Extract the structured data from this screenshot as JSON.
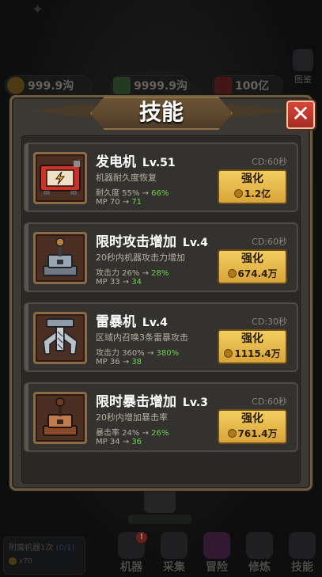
{
  "resources": [
    {
      "icon": "coin-icon",
      "value": "999.9沟"
    },
    {
      "icon": "cash-icon",
      "value": "9999.9沟"
    },
    {
      "icon": "gem-icon",
      "value": "100亿"
    }
  ],
  "handbook_label": "图鉴",
  "panel": {
    "title": "技能",
    "close_symbol": "✕"
  },
  "skills": [
    {
      "name": "发电机",
      "level": "Lv.51",
      "cd": "CD:60秒",
      "desc": "机器耐久度恢复",
      "stat": "耐久度 55% → ",
      "stat_new": "66%",
      "mp": "MP 70 → ",
      "mp_new": "71",
      "btn": "强化",
      "cost": "1.2亿",
      "icon": "generator-icon"
    },
    {
      "name": "限时攻击增加",
      "level": "Lv.4",
      "cd": "CD:60秒",
      "desc": "20秒内机器攻击力增加",
      "stat": "攻击力 26% → ",
      "stat_new": "28%",
      "mp": "MP 33 → ",
      "mp_new": "34",
      "btn": "强化",
      "cost": "674.4万",
      "icon": "attack-lever-icon"
    },
    {
      "name": "雷暴机",
      "level": "Lv.4",
      "cd": "CD:30秒",
      "desc": "区域内召唤3条雷暴攻击",
      "stat": "攻击力 360% → ",
      "stat_new": "380%",
      "mp": "MP 36 → ",
      "mp_new": "38",
      "btn": "强化",
      "cost": "1115.4万",
      "icon": "thunder-claw-icon"
    },
    {
      "name": "限时暴击增加",
      "level": "Lv.3",
      "cd": "CD:60秒",
      "desc": "20秒内增加暴击率",
      "stat": "暴击率 24% → ",
      "stat_new": "26%",
      "mp": "MP 34 → ",
      "mp_new": "36",
      "btn": "强化",
      "cost": "761.4万",
      "icon": "crit-lever-icon"
    }
  ],
  "bottom": {
    "enemy_text": "附魔机器1次",
    "enemy_count": "(0/1)",
    "reward": "x70",
    "nav": [
      {
        "label": "机器",
        "badge": "!"
      },
      {
        "label": "采集",
        "badge": ""
      },
      {
        "label": "冒险",
        "badge": ""
      },
      {
        "label": "修炼",
        "badge": ""
      },
      {
        "label": "技能",
        "badge": ""
      }
    ]
  },
  "colors": {
    "upgrade_button": "#e6b94a",
    "increase_text": "#6cd34e",
    "close_button": "#c23a2e"
  }
}
